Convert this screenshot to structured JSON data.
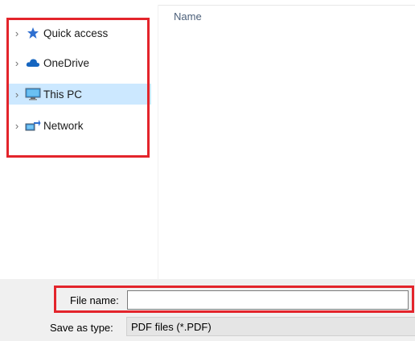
{
  "nav": {
    "items": [
      {
        "label": "Quick access",
        "icon": "star-icon",
        "selected": false
      },
      {
        "label": "OneDrive",
        "icon": "cloud-icon",
        "selected": false
      },
      {
        "label": "This PC",
        "icon": "computer-icon",
        "selected": true
      },
      {
        "label": "Network",
        "icon": "network-icon",
        "selected": false
      }
    ]
  },
  "file_list": {
    "column_header": "Name"
  },
  "save_form": {
    "file_name_label": "File name:",
    "file_name_value": "",
    "save_as_type_label": "Save as type:",
    "save_as_type_value": "PDF files (*.PDF)"
  },
  "colors": {
    "highlight_box": "#e3242b",
    "selected_bg": "#cce8ff",
    "bottom_panel_bg": "#f0f0f0"
  }
}
